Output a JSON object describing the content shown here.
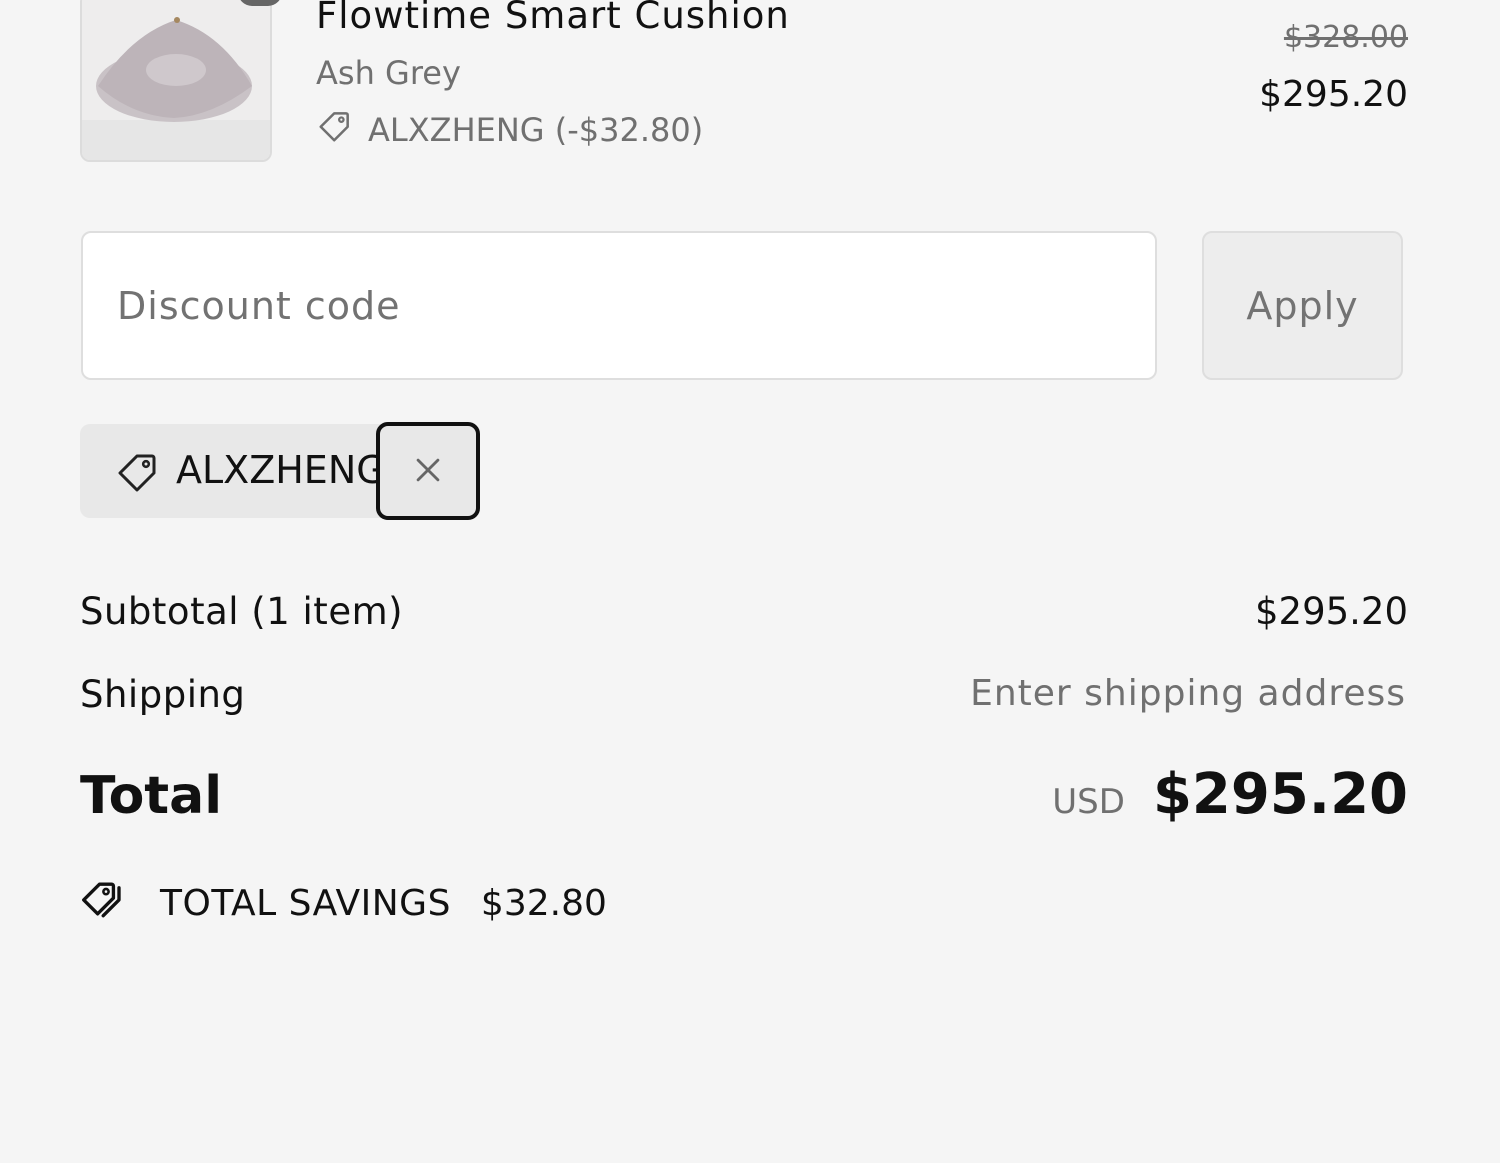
{
  "product": {
    "title": "Flowtime Smart Cushion",
    "variant": "Ash Grey",
    "discount_line": "ALXZHENG (-$32.80)",
    "original_price": "$328.00",
    "price": "$295.20"
  },
  "discount_form": {
    "placeholder": "Discount code",
    "apply_label": "Apply"
  },
  "applied_code": {
    "code": "ALXZHENG"
  },
  "summary": {
    "subtotal_label": "Subtotal (1 item)",
    "subtotal_value": "$295.20",
    "shipping_label": "Shipping",
    "shipping_value": "Enter shipping address",
    "total_label": "Total",
    "currency": "USD",
    "total_value": "$295.20",
    "savings_label": "TOTAL SAVINGS",
    "savings_value": "$32.80"
  },
  "icons": {
    "tag": "tag-icon",
    "close": "close-icon",
    "savings": "savings-tags-icon"
  },
  "colors": {
    "background": "#f5f5f5",
    "muted_text": "#707070",
    "chip_background": "#e8e8e8"
  }
}
